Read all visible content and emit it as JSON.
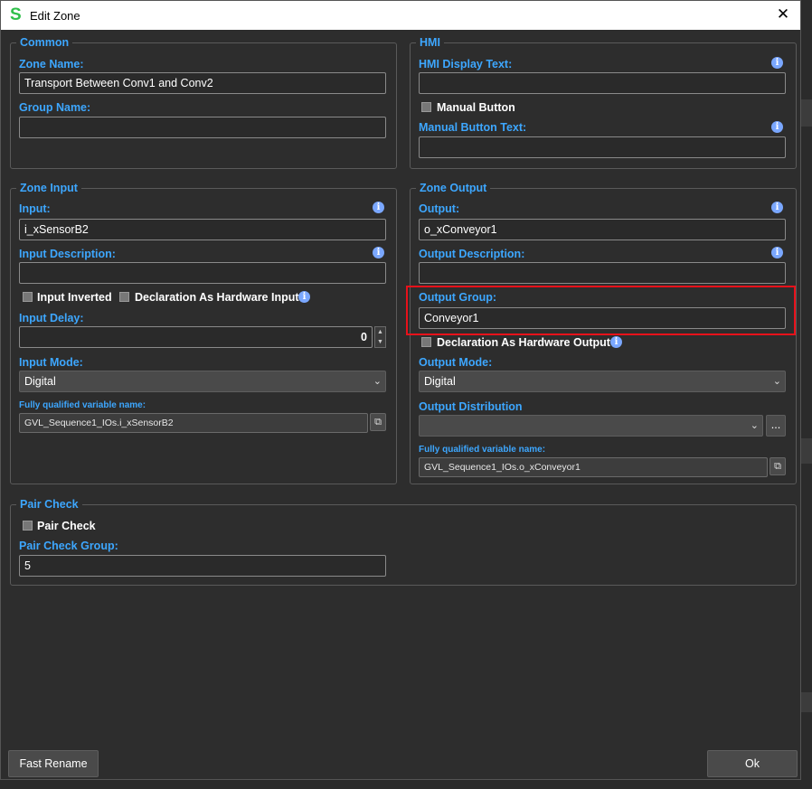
{
  "window": {
    "title": "Edit Zone",
    "logo": "S",
    "close_icon": "✕"
  },
  "common": {
    "legend": "Common",
    "zone_name_label": "Zone Name:",
    "zone_name_value": "Transport Between Conv1 and Conv2",
    "group_name_label": "Group Name:",
    "group_name_value": ""
  },
  "hmi": {
    "legend": "HMI",
    "display_text_label": "HMI Display Text:",
    "display_text_value": "",
    "manual_button_label": "Manual Button",
    "manual_button_checked": false,
    "manual_button_text_label": "Manual Button Text:",
    "manual_button_text_value": ""
  },
  "zone_input": {
    "legend": "Zone Input",
    "input_label": "Input:",
    "input_value": "i_xSensorB2",
    "description_label": "Input Description:",
    "description_value": "",
    "inverted_label": "Input Inverted",
    "inverted_checked": false,
    "hardware_label": "Declaration As Hardware Input",
    "hardware_checked": false,
    "delay_label": "Input Delay:",
    "delay_value": "0",
    "mode_label": "Input Mode:",
    "mode_value": "Digital",
    "fq_label": "Fully qualified variable name:",
    "fq_value": "GVL_Sequence1_IOs.i_xSensorB2"
  },
  "zone_output": {
    "legend": "Zone Output",
    "output_label": "Output:",
    "output_value": "o_xConveyor1",
    "description_label": "Output Description:",
    "description_value": "",
    "group_label": "Output Group:",
    "group_value": "Conveyor1",
    "hardware_label": "Declaration As Hardware Output",
    "hardware_checked": false,
    "mode_label": "Output Mode:",
    "mode_value": "Digital",
    "distribution_label": "Output Distribution",
    "distribution_value": "",
    "distribution_button": "...",
    "fq_label": "Fully qualified variable name:",
    "fq_value": "GVL_Sequence1_IOs.o_xConveyor1"
  },
  "pair_check": {
    "legend": "Pair Check",
    "pair_check_label": "Pair Check",
    "pair_check_checked": false,
    "group_label": "Pair Check Group:",
    "group_value": "5"
  },
  "footer": {
    "fast_rename": "Fast Rename",
    "ok": "Ok"
  },
  "icons": {
    "info": "info-icon",
    "copy": "copy-icon",
    "chevron": "chevron-down-icon",
    "close": "close-icon"
  },
  "colors": {
    "accent": "#3da7ff",
    "highlight": "#e8111a",
    "logo": "#2fbf4a"
  }
}
